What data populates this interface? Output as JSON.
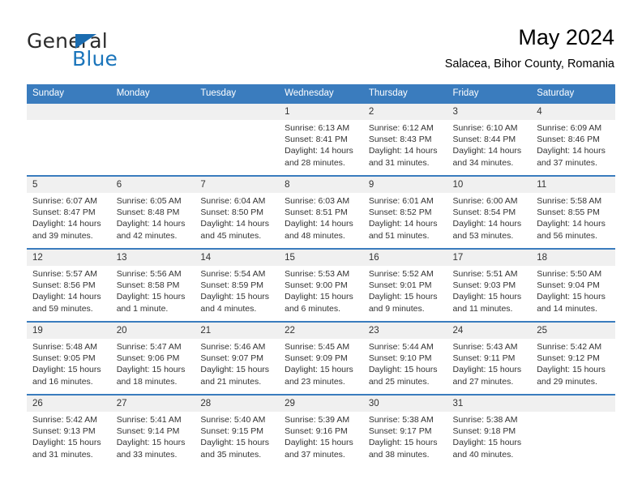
{
  "brand": {
    "name_part1": "General",
    "name_part2": "Blue",
    "accent_color": "#1b75bb"
  },
  "header": {
    "month_title": "May 2024",
    "location": "Salacea, Bihor County, Romania"
  },
  "theme": {
    "header_row_bg": "#3a7cbe",
    "daynum_bg": "#f0f0f0",
    "text_color": "#333333"
  },
  "calendar": {
    "weekday_headers": [
      "Sunday",
      "Monday",
      "Tuesday",
      "Wednesday",
      "Thursday",
      "Friday",
      "Saturday"
    ],
    "weeks": [
      [
        {
          "day": "",
          "blank": true,
          "sunrise": "",
          "sunset": "",
          "daylight_line1": "",
          "daylight_line2": ""
        },
        {
          "day": "",
          "blank": true,
          "sunrise": "",
          "sunset": "",
          "daylight_line1": "",
          "daylight_line2": ""
        },
        {
          "day": "",
          "blank": true,
          "sunrise": "",
          "sunset": "",
          "daylight_line1": "",
          "daylight_line2": ""
        },
        {
          "day": "1",
          "blank": false,
          "sunrise": "Sunrise: 6:13 AM",
          "sunset": "Sunset: 8:41 PM",
          "daylight_line1": "Daylight: 14 hours",
          "daylight_line2": "and 28 minutes."
        },
        {
          "day": "2",
          "blank": false,
          "sunrise": "Sunrise: 6:12 AM",
          "sunset": "Sunset: 8:43 PM",
          "daylight_line1": "Daylight: 14 hours",
          "daylight_line2": "and 31 minutes."
        },
        {
          "day": "3",
          "blank": false,
          "sunrise": "Sunrise: 6:10 AM",
          "sunset": "Sunset: 8:44 PM",
          "daylight_line1": "Daylight: 14 hours",
          "daylight_line2": "and 34 minutes."
        },
        {
          "day": "4",
          "blank": false,
          "sunrise": "Sunrise: 6:09 AM",
          "sunset": "Sunset: 8:46 PM",
          "daylight_line1": "Daylight: 14 hours",
          "daylight_line2": "and 37 minutes."
        }
      ],
      [
        {
          "day": "5",
          "blank": false,
          "sunrise": "Sunrise: 6:07 AM",
          "sunset": "Sunset: 8:47 PM",
          "daylight_line1": "Daylight: 14 hours",
          "daylight_line2": "and 39 minutes."
        },
        {
          "day": "6",
          "blank": false,
          "sunrise": "Sunrise: 6:05 AM",
          "sunset": "Sunset: 8:48 PM",
          "daylight_line1": "Daylight: 14 hours",
          "daylight_line2": "and 42 minutes."
        },
        {
          "day": "7",
          "blank": false,
          "sunrise": "Sunrise: 6:04 AM",
          "sunset": "Sunset: 8:50 PM",
          "daylight_line1": "Daylight: 14 hours",
          "daylight_line2": "and 45 minutes."
        },
        {
          "day": "8",
          "blank": false,
          "sunrise": "Sunrise: 6:03 AM",
          "sunset": "Sunset: 8:51 PM",
          "daylight_line1": "Daylight: 14 hours",
          "daylight_line2": "and 48 minutes."
        },
        {
          "day": "9",
          "blank": false,
          "sunrise": "Sunrise: 6:01 AM",
          "sunset": "Sunset: 8:52 PM",
          "daylight_line1": "Daylight: 14 hours",
          "daylight_line2": "and 51 minutes."
        },
        {
          "day": "10",
          "blank": false,
          "sunrise": "Sunrise: 6:00 AM",
          "sunset": "Sunset: 8:54 PM",
          "daylight_line1": "Daylight: 14 hours",
          "daylight_line2": "and 53 minutes."
        },
        {
          "day": "11",
          "blank": false,
          "sunrise": "Sunrise: 5:58 AM",
          "sunset": "Sunset: 8:55 PM",
          "daylight_line1": "Daylight: 14 hours",
          "daylight_line2": "and 56 minutes."
        }
      ],
      [
        {
          "day": "12",
          "blank": false,
          "sunrise": "Sunrise: 5:57 AM",
          "sunset": "Sunset: 8:56 PM",
          "daylight_line1": "Daylight: 14 hours",
          "daylight_line2": "and 59 minutes."
        },
        {
          "day": "13",
          "blank": false,
          "sunrise": "Sunrise: 5:56 AM",
          "sunset": "Sunset: 8:58 PM",
          "daylight_line1": "Daylight: 15 hours",
          "daylight_line2": "and 1 minute."
        },
        {
          "day": "14",
          "blank": false,
          "sunrise": "Sunrise: 5:54 AM",
          "sunset": "Sunset: 8:59 PM",
          "daylight_line1": "Daylight: 15 hours",
          "daylight_line2": "and 4 minutes."
        },
        {
          "day": "15",
          "blank": false,
          "sunrise": "Sunrise: 5:53 AM",
          "sunset": "Sunset: 9:00 PM",
          "daylight_line1": "Daylight: 15 hours",
          "daylight_line2": "and 6 minutes."
        },
        {
          "day": "16",
          "blank": false,
          "sunrise": "Sunrise: 5:52 AM",
          "sunset": "Sunset: 9:01 PM",
          "daylight_line1": "Daylight: 15 hours",
          "daylight_line2": "and 9 minutes."
        },
        {
          "day": "17",
          "blank": false,
          "sunrise": "Sunrise: 5:51 AM",
          "sunset": "Sunset: 9:03 PM",
          "daylight_line1": "Daylight: 15 hours",
          "daylight_line2": "and 11 minutes."
        },
        {
          "day": "18",
          "blank": false,
          "sunrise": "Sunrise: 5:50 AM",
          "sunset": "Sunset: 9:04 PM",
          "daylight_line1": "Daylight: 15 hours",
          "daylight_line2": "and 14 minutes."
        }
      ],
      [
        {
          "day": "19",
          "blank": false,
          "sunrise": "Sunrise: 5:48 AM",
          "sunset": "Sunset: 9:05 PM",
          "daylight_line1": "Daylight: 15 hours",
          "daylight_line2": "and 16 minutes."
        },
        {
          "day": "20",
          "blank": false,
          "sunrise": "Sunrise: 5:47 AM",
          "sunset": "Sunset: 9:06 PM",
          "daylight_line1": "Daylight: 15 hours",
          "daylight_line2": "and 18 minutes."
        },
        {
          "day": "21",
          "blank": false,
          "sunrise": "Sunrise: 5:46 AM",
          "sunset": "Sunset: 9:07 PM",
          "daylight_line1": "Daylight: 15 hours",
          "daylight_line2": "and 21 minutes."
        },
        {
          "day": "22",
          "blank": false,
          "sunrise": "Sunrise: 5:45 AM",
          "sunset": "Sunset: 9:09 PM",
          "daylight_line1": "Daylight: 15 hours",
          "daylight_line2": "and 23 minutes."
        },
        {
          "day": "23",
          "blank": false,
          "sunrise": "Sunrise: 5:44 AM",
          "sunset": "Sunset: 9:10 PM",
          "daylight_line1": "Daylight: 15 hours",
          "daylight_line2": "and 25 minutes."
        },
        {
          "day": "24",
          "blank": false,
          "sunrise": "Sunrise: 5:43 AM",
          "sunset": "Sunset: 9:11 PM",
          "daylight_line1": "Daylight: 15 hours",
          "daylight_line2": "and 27 minutes."
        },
        {
          "day": "25",
          "blank": false,
          "sunrise": "Sunrise: 5:42 AM",
          "sunset": "Sunset: 9:12 PM",
          "daylight_line1": "Daylight: 15 hours",
          "daylight_line2": "and 29 minutes."
        }
      ],
      [
        {
          "day": "26",
          "blank": false,
          "sunrise": "Sunrise: 5:42 AM",
          "sunset": "Sunset: 9:13 PM",
          "daylight_line1": "Daylight: 15 hours",
          "daylight_line2": "and 31 minutes."
        },
        {
          "day": "27",
          "blank": false,
          "sunrise": "Sunrise: 5:41 AM",
          "sunset": "Sunset: 9:14 PM",
          "daylight_line1": "Daylight: 15 hours",
          "daylight_line2": "and 33 minutes."
        },
        {
          "day": "28",
          "blank": false,
          "sunrise": "Sunrise: 5:40 AM",
          "sunset": "Sunset: 9:15 PM",
          "daylight_line1": "Daylight: 15 hours",
          "daylight_line2": "and 35 minutes."
        },
        {
          "day": "29",
          "blank": false,
          "sunrise": "Sunrise: 5:39 AM",
          "sunset": "Sunset: 9:16 PM",
          "daylight_line1": "Daylight: 15 hours",
          "daylight_line2": "and 37 minutes."
        },
        {
          "day": "30",
          "blank": false,
          "sunrise": "Sunrise: 5:38 AM",
          "sunset": "Sunset: 9:17 PM",
          "daylight_line1": "Daylight: 15 hours",
          "daylight_line2": "and 38 minutes."
        },
        {
          "day": "31",
          "blank": false,
          "sunrise": "Sunrise: 5:38 AM",
          "sunset": "Sunset: 9:18 PM",
          "daylight_line1": "Daylight: 15 hours",
          "daylight_line2": "and 40 minutes."
        },
        {
          "day": "",
          "blank": true,
          "sunrise": "",
          "sunset": "",
          "daylight_line1": "",
          "daylight_line2": ""
        }
      ]
    ]
  }
}
